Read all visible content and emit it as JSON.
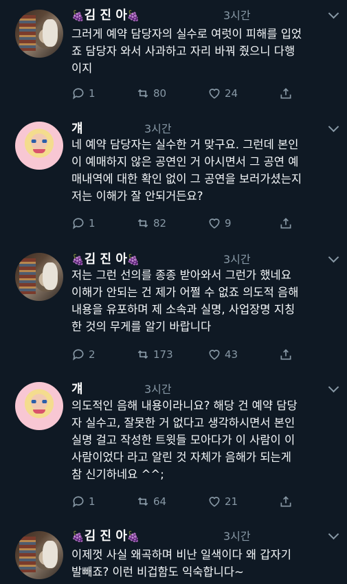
{
  "tweets": [
    {
      "author": "김 진 아",
      "deco_left": "🍇",
      "deco_right": "🍇",
      "time": "3시간",
      "lines": [
        "그러게 예약 담당자의 실수로 여럿이 피해를 입었",
        "죠 담당자 와서 사과하고 자리 바꿔 줬으니 다행",
        "이지"
      ],
      "replies": "1",
      "retweets": "80",
      "likes": "24"
    },
    {
      "author": "걔",
      "time": "3시간",
      "lines": [
        "네 예약 담당자는 실수한 거 맞구요. 그런데 본인",
        "이 예매하지 않은 공연인 거 아시면서 그 공연 예",
        "매내역에 대한 확인 없이 그 공연을 보러가셨는지",
        "저는 이해가 잘 안되거든요?"
      ],
      "replies": "1",
      "retweets": "82",
      "likes": "9"
    },
    {
      "author": "김 진 아",
      "deco_left": "🍇",
      "deco_right": "🍇",
      "time": "3시간",
      "lines": [
        "저는 그런 선의를 종종 받아와서 그런가 했네요",
        "이해가 안되는 건 제가 어쩔 수 없죠 의도적 음해",
        "내용을 유포하며 제 소속과 실명, 사업장명 지칭",
        "한 것의 무게를 알기 바랍니다"
      ],
      "replies": "2",
      "retweets": "173",
      "likes": "43"
    },
    {
      "author": "걔",
      "time": "3시간",
      "lines": [
        "의도적인 음해 내용이라니요? 해당 건 예약 담당",
        "자 실수고, 잘못한 거 없다고 생각하시면서 본인",
        "실명 걸고 작성한 트윗들 모아다가 이 사람이 이",
        "사람이었다 라고 알린 것 자체가 음해가 되는게",
        "참 신기하네요 ^^;"
      ],
      "replies": "1",
      "retweets": "64",
      "likes": "21"
    },
    {
      "author": "김 진 아",
      "deco_left": "🍇",
      "deco_right": "🍇",
      "time": "3시간",
      "lines": [
        "이제껏 사실 왜곡하며 비난 일색이다 왜 갑자기",
        "발빼죠? 이런 비겁함도 익숙합니다~"
      ]
    }
  ]
}
